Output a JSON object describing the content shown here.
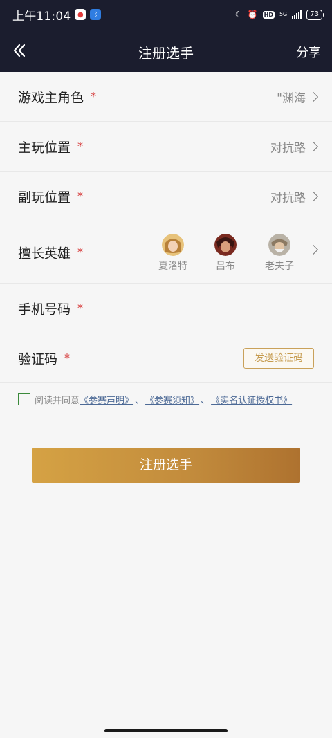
{
  "status_bar": {
    "time": "上午11:04",
    "network": "5G",
    "hd": "HD",
    "battery": "73"
  },
  "nav": {
    "title": "注册选手",
    "share": "分享"
  },
  "form": {
    "rows": [
      {
        "label": "游戏主角色",
        "required": "*",
        "value": "\"渊海"
      },
      {
        "label": "主玩位置",
        "required": "*",
        "value": "对抗路"
      },
      {
        "label": "副玩位置",
        "required": "*",
        "value": "对抗路"
      }
    ],
    "heroes": {
      "label": "擅长英雄",
      "required": "*",
      "items": [
        {
          "name": "夏洛特"
        },
        {
          "name": "吕布"
        },
        {
          "name": "老夫子"
        }
      ]
    },
    "phone": {
      "label": "手机号码",
      "required": "*"
    },
    "code": {
      "label": "验证码",
      "required": "*",
      "button": "发送验证码"
    }
  },
  "agreement": {
    "prefix": "阅读并同意",
    "link1": "《参赛声明》",
    "link2": "《参赛须知》",
    "link3": "《实名认证授权书》",
    "separator": "、"
  },
  "register_button": "注册选手",
  "colors": {
    "header_bg": "#1b1d2e",
    "required": "#d42d2d",
    "accent_gold": "#c59a4d",
    "link": "#4d6a96"
  }
}
